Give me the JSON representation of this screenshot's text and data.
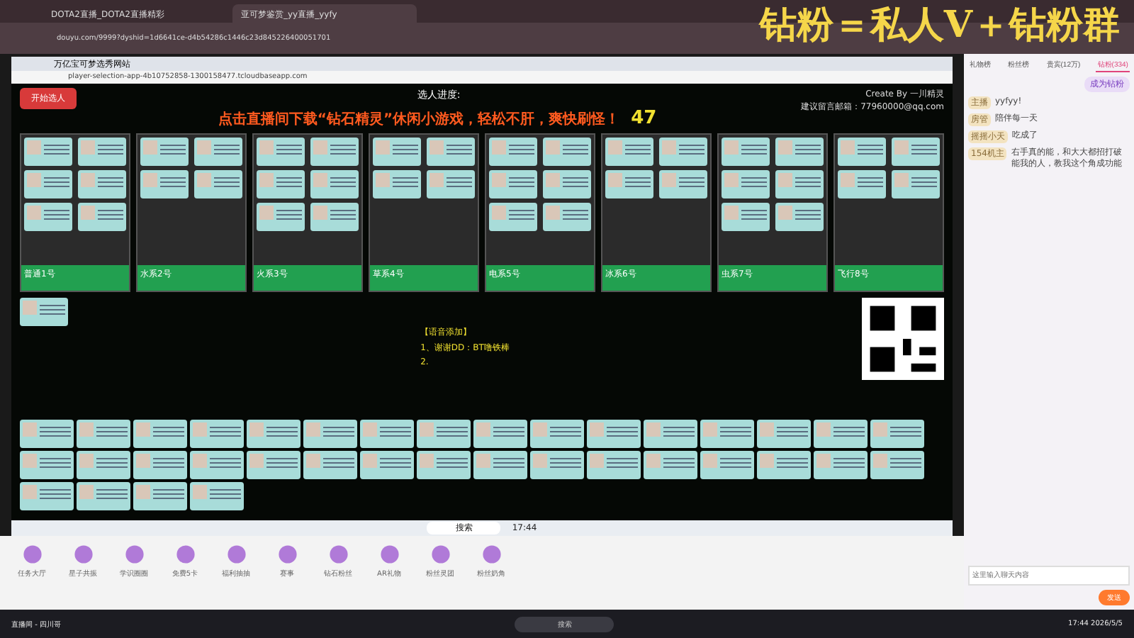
{
  "browser": {
    "tabs": [
      {
        "label": "DOTA2直播_DOTA2直播精彩",
        "selected": false
      },
      {
        "label": "亚可梦鉴赏_yy直播_yyfy",
        "selected": true
      }
    ],
    "url": "douyu.com/9999?dyshid=1d6641ce-d4b54286c1446c23d845226400051701"
  },
  "banner": "钻粉＝私人V＋钻粉群",
  "inner": {
    "tab": "万亿宝可梦选秀网站",
    "url": "player-selection-app-4b10752858-1300158477.tcloudbaseapp.com",
    "start_button": "开始选人",
    "progress_title": "选人进度:",
    "count": "47",
    "credit": "Create By 一川精灵",
    "contact": "建议留言邮箱：77960000@qq.com",
    "marquee": "点击直播间下载“钻石精灵”休闲小游戏，轻松不肝，爽快刷怪！",
    "teams": [
      {
        "label": "普通1号"
      },
      {
        "label": "水系2号"
      },
      {
        "label": "火系3号"
      },
      {
        "label": "草系4号"
      },
      {
        "label": "电系5号"
      },
      {
        "label": "冰系6号"
      },
      {
        "label": "虫系7号"
      },
      {
        "label": "飞行8号"
      }
    ],
    "voice_title": "【语音添加】",
    "voice_lines": [
      "1、谢谢DD：BT噜铁棒",
      "2."
    ],
    "search": "搜索",
    "time": "17:44"
  },
  "gifts": [
    "任务大厅",
    "星子共振",
    "学识圈圈",
    "免费5卡",
    "福利抽抽",
    "赛事",
    "钻石粉丝",
    "AR礼物",
    "粉丝灵团",
    "粉丝奶角"
  ],
  "chat": {
    "tabs": [
      {
        "label": "礼物榜",
        "selected": false
      },
      {
        "label": "粉丝榜",
        "selected": false
      },
      {
        "label": "贵宾(12万)",
        "selected": false
      },
      {
        "label": "钻粉(334)",
        "selected": true
      }
    ],
    "join": "成为钻粉",
    "messages": [
      {
        "user": "主播",
        "text": "yyfyy!"
      },
      {
        "user": "房管",
        "text": "陪伴每一天"
      },
      {
        "user": "摇摇小天",
        "text": "吃成了"
      },
      {
        "user": "154机主",
        "text": "右手真的能，和大大都招打破能我的人，教我这个角成功能"
      }
    ],
    "placeholder": "这里输入聊天内容",
    "send": "发送"
  },
  "taskbar": {
    "app": "直播间 - 四川哥",
    "search": "搜索",
    "time": "17:44",
    "date": "2026/5/5"
  }
}
